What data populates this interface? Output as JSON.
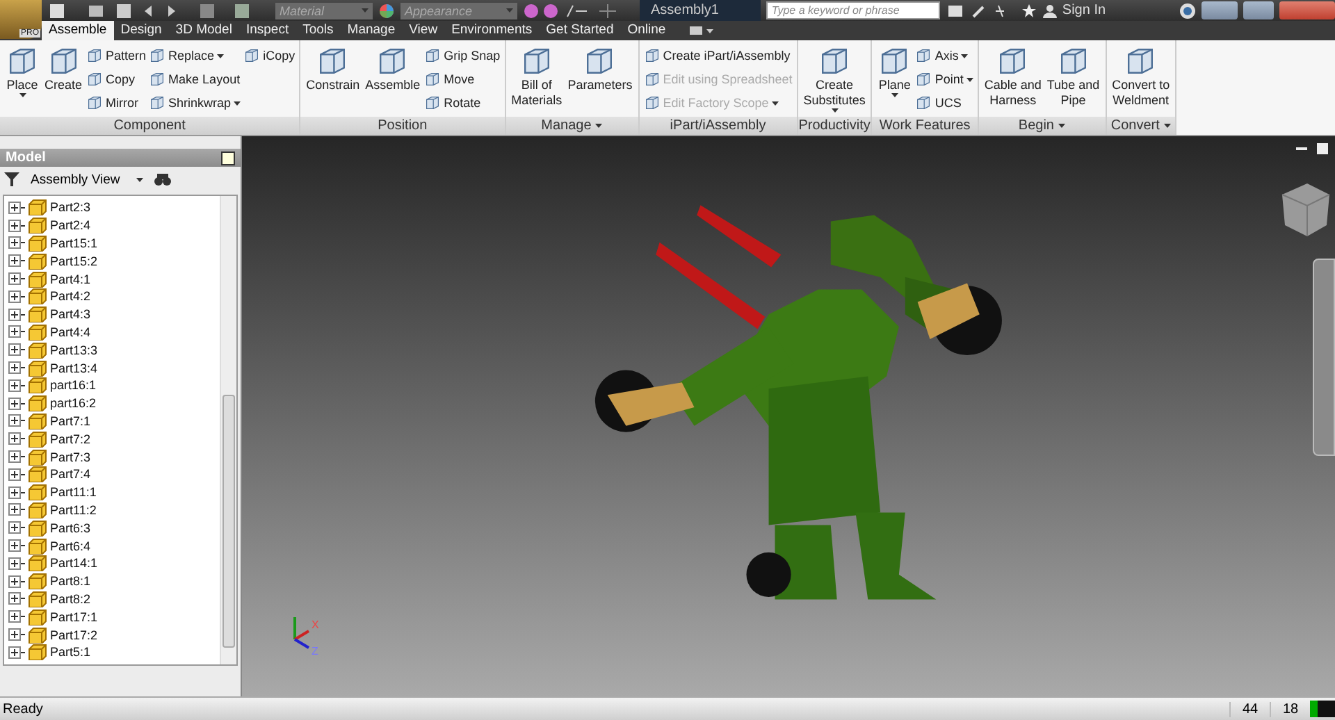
{
  "title_bar": {
    "edition": "PRO",
    "material_placeholder": "Material",
    "appearance_placeholder": "Appearance",
    "document_title": "Assembly1",
    "search_placeholder": "Type a keyword or phrase",
    "sign_in": "Sign In"
  },
  "tabs": [
    {
      "label": "Assemble",
      "selected": true
    },
    {
      "label": "Design",
      "selected": false
    },
    {
      "label": "3D Model",
      "selected": false
    },
    {
      "label": "Inspect",
      "selected": false
    },
    {
      "label": "Tools",
      "selected": false
    },
    {
      "label": "Manage",
      "selected": false
    },
    {
      "label": "View",
      "selected": false
    },
    {
      "label": "Environments",
      "selected": false
    },
    {
      "label": "Get Started",
      "selected": false
    },
    {
      "label": "Online",
      "selected": false
    }
  ],
  "ribbon": {
    "panels": [
      {
        "title": "Component",
        "menu": false,
        "columns": [
          {
            "kind": "large",
            "label": "Place",
            "dropdown": true
          },
          {
            "kind": "large",
            "label": "Create",
            "dropdown": false
          },
          {
            "kind": "stack",
            "items": [
              {
                "label": "Pattern",
                "dropdown": false,
                "disabled": false
              },
              {
                "label": "Copy",
                "dropdown": false,
                "disabled": false
              },
              {
                "label": "Mirror",
                "dropdown": false,
                "disabled": false
              }
            ]
          },
          {
            "kind": "stack",
            "items": [
              {
                "label": "Replace",
                "dropdown": true,
                "disabled": false
              },
              {
                "label": "Make Layout",
                "dropdown": false,
                "disabled": false
              },
              {
                "label": "Shrinkwrap",
                "dropdown": true,
                "disabled": false
              }
            ]
          },
          {
            "kind": "stack",
            "items": [
              {
                "label": "iCopy",
                "dropdown": false,
                "disabled": false
              }
            ]
          }
        ]
      },
      {
        "title": "Position",
        "menu": false,
        "columns": [
          {
            "kind": "large",
            "label": "Constrain",
            "dropdown": false
          },
          {
            "kind": "large",
            "label": "Assemble",
            "dropdown": false
          },
          {
            "kind": "stack",
            "items": [
              {
                "label": "Grip Snap",
                "dropdown": false,
                "disabled": false
              },
              {
                "label": "Move",
                "dropdown": false,
                "disabled": false
              },
              {
                "label": "Rotate",
                "dropdown": false,
                "disabled": false
              }
            ]
          }
        ]
      },
      {
        "title": "Manage",
        "menu": true,
        "columns": [
          {
            "kind": "large",
            "label": "Bill of\nMaterials",
            "dropdown": false
          },
          {
            "kind": "large",
            "label": "Parameters",
            "dropdown": false
          }
        ]
      },
      {
        "title": "iPart/iAssembly",
        "menu": false,
        "columns": [
          {
            "kind": "stack",
            "items": [
              {
                "label": "Create iPart/iAssembly",
                "dropdown": false,
                "disabled": false
              },
              {
                "label": "Edit using Spreadsheet",
                "dropdown": false,
                "disabled": true
              },
              {
                "label": "Edit Factory Scope",
                "dropdown": true,
                "disabled": true
              }
            ]
          }
        ]
      },
      {
        "title": "Productivity",
        "menu": false,
        "columns": [
          {
            "kind": "large",
            "label": "Create\nSubstitutes",
            "dropdown": true
          }
        ]
      },
      {
        "title": "Work Features",
        "menu": false,
        "columns": [
          {
            "kind": "large",
            "label": "Plane",
            "dropdown": true
          },
          {
            "kind": "stack",
            "items": [
              {
                "label": "Axis",
                "dropdown": true,
                "disabled": false
              },
              {
                "label": "Point",
                "dropdown": true,
                "disabled": false
              },
              {
                "label": "UCS",
                "dropdown": false,
                "disabled": false
              }
            ]
          }
        ]
      },
      {
        "title": "Begin",
        "menu": true,
        "columns": [
          {
            "kind": "large",
            "label": "Cable and\nHarness",
            "dropdown": false
          },
          {
            "kind": "large",
            "label": "Tube and\nPipe",
            "dropdown": false
          }
        ]
      },
      {
        "title": "Convert",
        "menu": true,
        "columns": [
          {
            "kind": "large",
            "label": "Convert to\nWeldment",
            "dropdown": false
          }
        ]
      }
    ]
  },
  "browser": {
    "title": "Model",
    "view": "Assembly View",
    "items": [
      {
        "name": "Part2:3"
      },
      {
        "name": "Part2:4"
      },
      {
        "name": "Part15:1"
      },
      {
        "name": "Part15:2"
      },
      {
        "name": "Part4:1"
      },
      {
        "name": "Part4:2"
      },
      {
        "name": "Part4:3"
      },
      {
        "name": "Part4:4"
      },
      {
        "name": "Part13:3"
      },
      {
        "name": "Part13:4"
      },
      {
        "name": "part16:1"
      },
      {
        "name": "part16:2"
      },
      {
        "name": "Part7:1"
      },
      {
        "name": "Part7:2"
      },
      {
        "name": "Part7:3"
      },
      {
        "name": "Part7:4"
      },
      {
        "name": "Part11:1"
      },
      {
        "name": "Part11:2"
      },
      {
        "name": "Part6:3"
      },
      {
        "name": "Part6:4"
      },
      {
        "name": "Part14:1"
      },
      {
        "name": "Part8:1"
      },
      {
        "name": "Part8:2"
      },
      {
        "name": "Part17:1"
      },
      {
        "name": "Part17:2"
      },
      {
        "name": "Part5:1"
      }
    ]
  },
  "viewport": {
    "triad_labels": [
      "X",
      "Z"
    ]
  },
  "status_bar": {
    "message": "Ready",
    "counts": [
      "44",
      "18"
    ]
  }
}
